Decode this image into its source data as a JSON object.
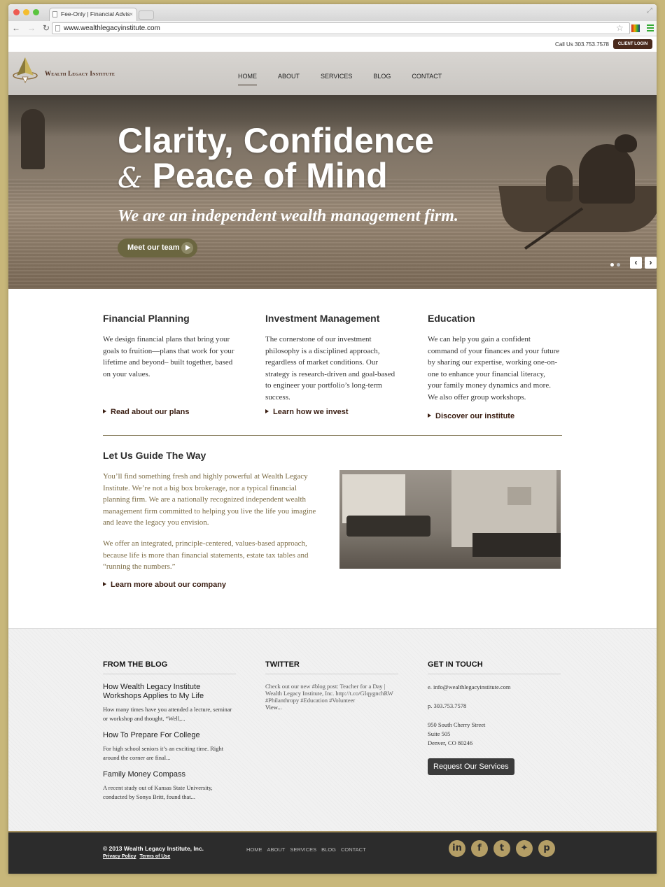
{
  "browser": {
    "tab_title": "Fee-Only | Financial Advis",
    "url": "www.wealthlegacyinstitute.com"
  },
  "utility": {
    "call_us": "Call Us 303.753.7578",
    "client_login": "CLIENT LOGIN"
  },
  "brand": {
    "name": "Wealth Legacy Institute"
  },
  "nav": {
    "items": [
      "HOME",
      "ABOUT",
      "SERVICES",
      "BLOG",
      "CONTACT"
    ],
    "active": "HOME"
  },
  "hero": {
    "line1": "Clarity, Confidence",
    "amp": "&",
    "line2": "Peace of Mind",
    "tagline": "We are an independent wealth management firm.",
    "cta": "Meet our team",
    "prev": "‹",
    "next": "›"
  },
  "services": [
    {
      "title": "Financial Planning",
      "body": "We design financial plans that bring your goals to fruition—plans that work for your lifetime and beyond– built together, based on your values.",
      "link": "Read about our plans"
    },
    {
      "title": "Investment Management",
      "body": "The cornerstone of our investment philosophy is a disciplined approach, regardless of market conditions. Our strategy is research-driven and goal-based to engineer your portfolio’s long-term success.",
      "link": "Learn how we invest"
    },
    {
      "title": "Education",
      "body": "We can help you gain a confident command of your finances and your future by sharing our expertise, working one-on-one to enhance your financial literacy, your family money dynamics and more. We also offer group workshops.",
      "link": "Discover our institute"
    }
  ],
  "guide": {
    "title": "Let Us Guide The Way",
    "p1": "You’ll find something fresh and highly powerful at Wealth Legacy Institute. We’re not a big box brokerage, nor a typical financial planning firm. We are a nationally recognized independent wealth management firm committed to helping you live the life you imagine and leave the legacy you envision.",
    "p2": "We offer an integrated, principle-centered, values-based approach, because life is more than financial statements, estate tax tables and “running the numbers.”",
    "link": "Learn more about our company"
  },
  "blog": {
    "heading": "FROM THE BLOG",
    "posts": [
      {
        "title": "How Wealth Legacy Institute Workshops Applies to My Life",
        "excerpt": "How many times have you attended a lecture, seminar or workshop and thought, “Well,..."
      },
      {
        "title": "How To Prepare For College",
        "excerpt": "For high school seniors it’s an exciting time.  Right around the corner are final..."
      },
      {
        "title": "Family Money Compass",
        "excerpt": "A recent study out of Kansas State University, conducted by Sonya Britt, found that..."
      }
    ]
  },
  "twitter": {
    "heading": "TWITTER",
    "tweet": "Check out our new #blog post: Teacher for a Day | Wealth Legacy Institute, Inc. http://t.co/GIqygnchRW #Philanthropy #Education #Volunteer",
    "view": "View..."
  },
  "contact": {
    "heading": "GET IN TOUCH",
    "email": "e. info@wealthlegacyinstitute.com",
    "phone": "p. 303.753.7578",
    "addr1": "950 South Cherry Street",
    "addr2": "Suite 505",
    "addr3": "Denver, CO 80246",
    "button": "Request Our Services"
  },
  "footer": {
    "copyright": "© 2013 Wealth Legacy Institute, Inc.",
    "privacy": "Privacy Policy",
    "terms": "Terms of Use",
    "nav": [
      "HOME",
      "ABOUT",
      "SERVICES",
      "BLOG",
      "CONTACT"
    ],
    "social": [
      {
        "name": "linkedin-icon",
        "glyph": "in"
      },
      {
        "name": "facebook-icon",
        "glyph": "f"
      },
      {
        "name": "twitter-icon",
        "glyph": "t"
      },
      {
        "name": "figure-icon",
        "glyph": "✦"
      },
      {
        "name": "pinterest-icon",
        "glyph": "p"
      }
    ]
  },
  "colors": {
    "page_bg": "#c8b77a",
    "brand_brown": "#4a2a1c",
    "accent_gold": "#b49e66",
    "guide_text": "#7a6a43",
    "cta_olive": "#6b6640"
  }
}
